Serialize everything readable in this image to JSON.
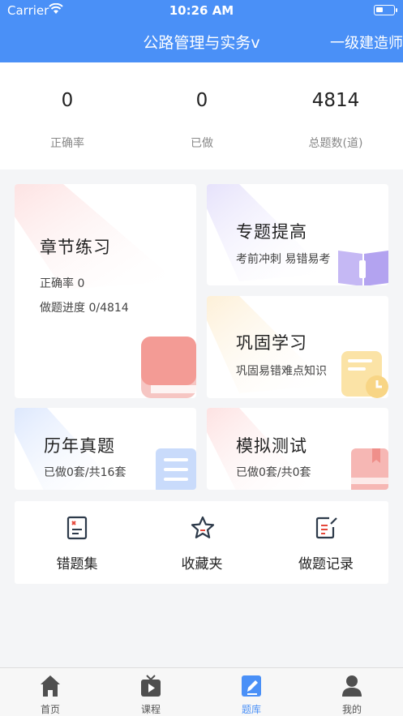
{
  "status_bar": {
    "carrier": "Carrier",
    "time": "10:26 AM"
  },
  "nav": {
    "title": "公路管理与实务v",
    "right": "一级建造师"
  },
  "stats": [
    {
      "value": "0",
      "label": "正确率"
    },
    {
      "value": "0",
      "label": "已做"
    },
    {
      "value": "4814",
      "label": "总题数(道)"
    }
  ],
  "cards": {
    "chapter": {
      "title": "章节练习",
      "line1": "正确率 0",
      "line2": "做题进度 0/4814"
    },
    "topic": {
      "title": "专题提高",
      "sub": "考前冲刺   易错易考"
    },
    "consolidate": {
      "title": "巩固学习",
      "sub": "巩固易错难点知识"
    },
    "past": {
      "title": "历年真题",
      "sub": "已做0套/共16套"
    },
    "mock": {
      "title": "模拟测试",
      "sub": "已做0套/共0套"
    }
  },
  "quick": [
    {
      "label": "错题集",
      "icon": "wrong-questions-icon"
    },
    {
      "label": "收藏夹",
      "icon": "star-icon"
    },
    {
      "label": "做题记录",
      "icon": "edit-record-icon"
    }
  ],
  "tabs": [
    {
      "label": "首页",
      "icon": "home-icon"
    },
    {
      "label": "课程",
      "icon": "tv-icon"
    },
    {
      "label": "题库",
      "icon": "question-bank-icon"
    },
    {
      "label": "我的",
      "icon": "user-icon"
    }
  ],
  "colors": {
    "primary": "#4a90f7",
    "tab_active": "#4a90f7",
    "background": "#f4f5f7"
  }
}
